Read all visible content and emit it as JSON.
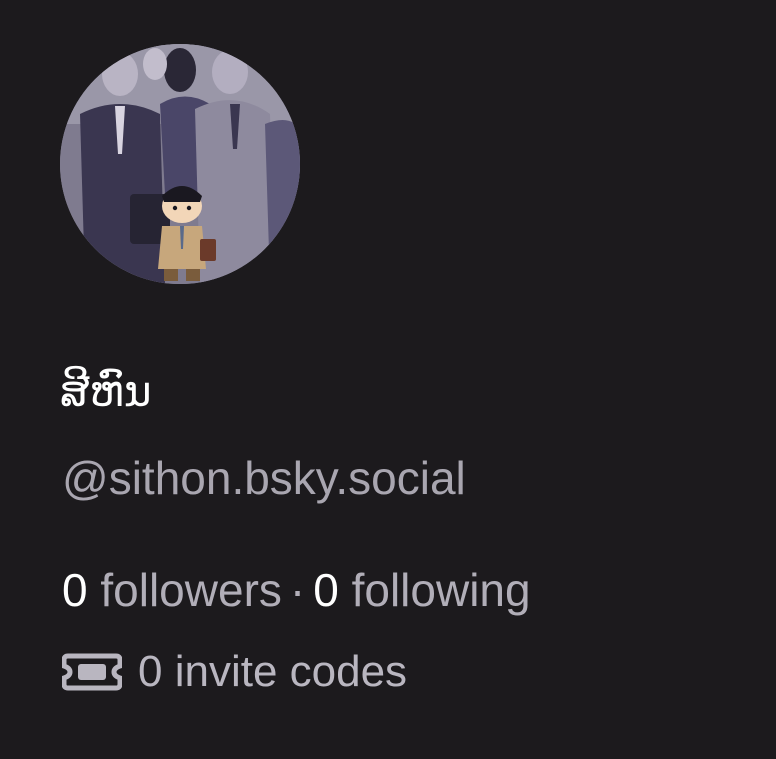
{
  "profile": {
    "display_name": "ສີຫົນ",
    "handle": "@sithon.bsky.social",
    "avatar_icon": "avatar-image"
  },
  "stats": {
    "followers_count": "0",
    "followers_label": "followers",
    "separator": "·",
    "following_count": "0",
    "following_label": "following"
  },
  "invites": {
    "icon": "ticket-icon",
    "label": "0 invite codes"
  },
  "colors": {
    "background": "#1c1a1d",
    "primary_text": "#ffffff",
    "secondary_text": "#a9a6b0"
  }
}
